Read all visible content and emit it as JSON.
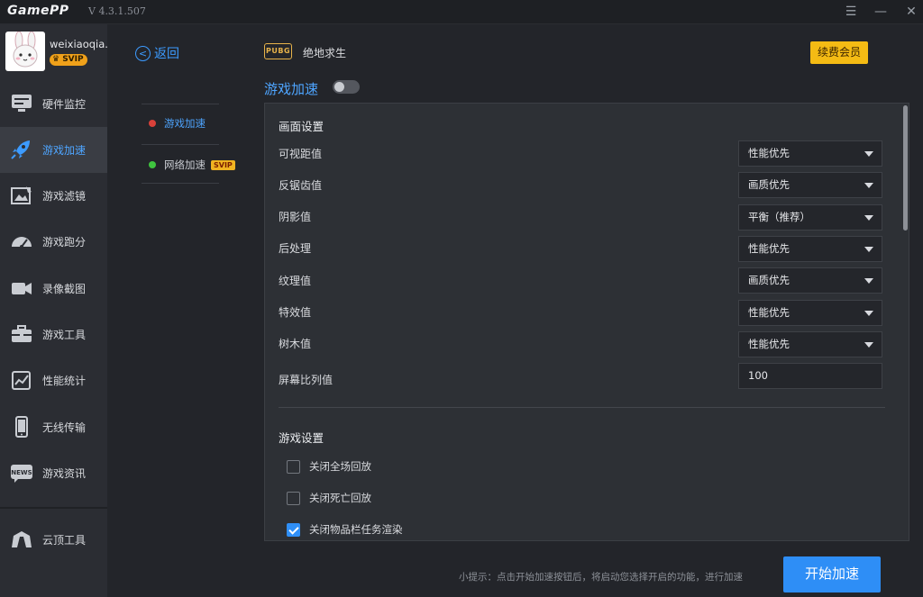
{
  "titlebar": {
    "logo": "GamePP",
    "version": "V 4.3.1.507"
  },
  "profile": {
    "username": "weixiaoqia..",
    "badge": "SVIP"
  },
  "sidebar": {
    "items": [
      {
        "label": "硬件监控",
        "icon": "hardware-monitor-icon"
      },
      {
        "label": "游戏加速",
        "icon": "rocket-icon",
        "active": true
      },
      {
        "label": "游戏滤镜",
        "icon": "filter-icon"
      },
      {
        "label": "游戏跑分",
        "icon": "speedometer-icon"
      },
      {
        "label": "录像截图",
        "icon": "video-camera-icon"
      },
      {
        "label": "游戏工具",
        "icon": "toolbox-icon"
      },
      {
        "label": "性能统计",
        "icon": "chart-clipboard-icon"
      },
      {
        "label": "无线传输",
        "icon": "phone-icon"
      },
      {
        "label": "游戏资讯",
        "icon": "news-icon"
      },
      {
        "label": "云顶工具",
        "icon": "cloud-top-icon"
      }
    ]
  },
  "back_label": "返回",
  "submenu": [
    {
      "label": "游戏加速",
      "dot_color": "#d9413a",
      "active": true
    },
    {
      "label": "网络加速",
      "dot_color": "#3fc43f",
      "badge": "SVIP"
    }
  ],
  "game": {
    "logo_text": "PUBG",
    "name": "绝地求生"
  },
  "renew_label": "续费会员",
  "accel_title": "游戏加速",
  "toggle_on": false,
  "graphics": {
    "title": "画面设置",
    "rows": [
      {
        "label": "可视距值",
        "value": "性能优先"
      },
      {
        "label": "反锯齿值",
        "value": "画质优先"
      },
      {
        "label": "阴影值",
        "value": "平衡（推荐）"
      },
      {
        "label": "后处理",
        "value": "性能优先"
      },
      {
        "label": "纹理值",
        "value": "画质优先"
      },
      {
        "label": "特效值",
        "value": "性能优先"
      },
      {
        "label": "树木值",
        "value": "性能优先"
      }
    ],
    "ratio_label": "屏幕比列值",
    "ratio_value": "100"
  },
  "game_settings": {
    "title": "游戏设置",
    "options": [
      {
        "label": "关闭全场回放",
        "checked": false
      },
      {
        "label": "关闭死亡回放",
        "checked": false
      },
      {
        "label": "关闭物品栏任务渲染",
        "checked": true
      }
    ]
  },
  "footer": {
    "hint": "小提示：点击开始加速按钮后，将启动您选择开启的功能，进行加速",
    "start_label": "开始加速"
  },
  "colors": {
    "accent": "#2e8ef6",
    "renew": "#f4bb14",
    "sidebar_bg": "#2b2d33"
  }
}
